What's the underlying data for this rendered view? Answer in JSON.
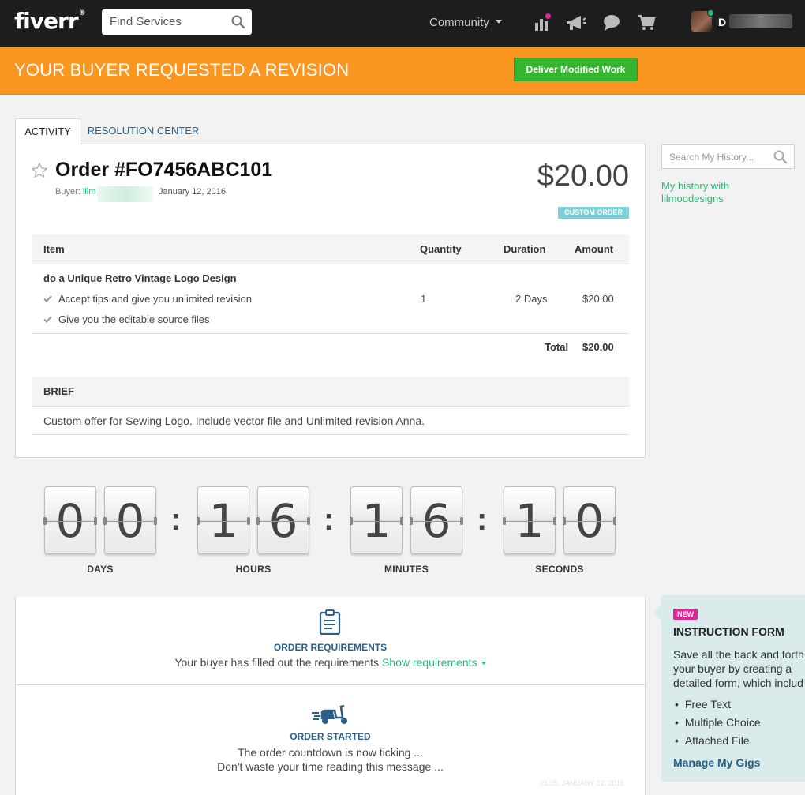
{
  "nav": {
    "logo": "fiverr",
    "logo_mark": "®",
    "search_placeholder": "Find Services",
    "community_label": "Community",
    "username": "D",
    "icons": [
      "stats-icon",
      "megaphone-icon",
      "chat-icon",
      "cart-icon"
    ]
  },
  "banner": {
    "title": "YOUR BUYER REQUESTED A REVISION",
    "deliver_label": "Deliver Modified Work"
  },
  "tabs": [
    {
      "label": "ACTIVITY",
      "active": true
    },
    {
      "label": "RESOLUTION CENTER",
      "active": false
    }
  ],
  "order": {
    "title": "Order #FO7456ABC101",
    "buyer_label": "Buyer:",
    "buyer_name": "lilm",
    "date": "January 12, 2016",
    "price": "$20.00",
    "badge": "CUSTOM ORDER",
    "table": {
      "headers": {
        "item": "Item",
        "quantity": "Quantity",
        "duration": "Duration",
        "amount": "Amount"
      },
      "gig": "do a Unique Retro Vintage Logo Design",
      "extras": [
        "Accept tips and give you unlimited revision",
        "Give you the editable source files"
      ],
      "quantity": "1",
      "duration": "2 Days",
      "amount": "$20.00",
      "total_label": "Total",
      "total_value": "$20.00"
    },
    "brief": {
      "heading": "BRIEF",
      "text": "Custom offer for Sewing Logo. Include vector file and Unlimited revision Anna."
    }
  },
  "sidebar": {
    "search_placeholder": "Search My History...",
    "history_link": "My history with lilmoodesigns"
  },
  "countdown": {
    "digits": [
      "0",
      "0",
      "1",
      "6",
      "1",
      "6",
      "1",
      "0"
    ],
    "colon": ":",
    "units": [
      "DAYS",
      "HOURS",
      "MINUTES",
      "SECONDS"
    ]
  },
  "feed": {
    "requirements": {
      "title": "ORDER REQUIREMENTS",
      "text": "Your buyer has filled out the requirements",
      "link": "Show requirements"
    },
    "started": {
      "title": "ORDER STARTED",
      "line1": "The order countdown is now ticking ...",
      "line2": "Don't waste your time reading this message ...",
      "faint_date": "01:05, JANUARY 12, 2016"
    }
  },
  "promo": {
    "badge": "NEW",
    "title": "INSTRUCTION FORM",
    "text_lines": [
      "Save all the back and forth",
      "your buyer by creating a",
      "detailed form, which includ"
    ],
    "list": [
      "Free Text",
      "Multiple Choice",
      "Attached File"
    ],
    "link": "Manage My Gigs"
  },
  "colors": {
    "brand_green": "#1dbf73",
    "banner_orange": "#fb9621",
    "button_green": "#35b52f",
    "link_blue": "#2a5f86",
    "promo_bg": "#d9ebeb"
  }
}
